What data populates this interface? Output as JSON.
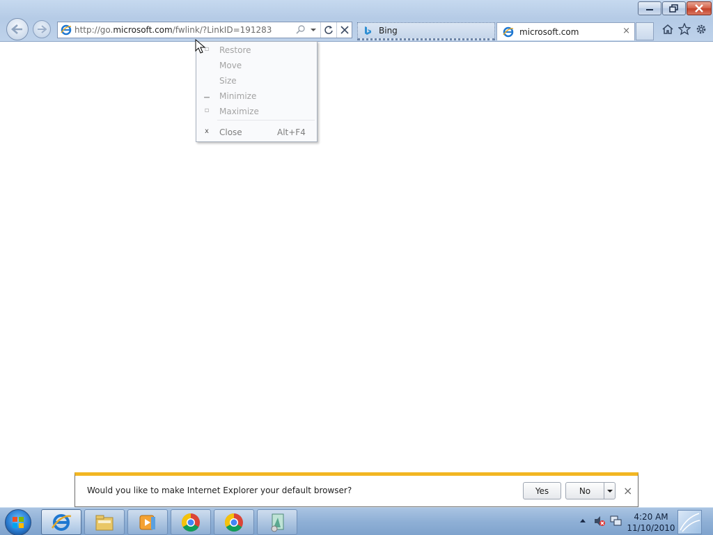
{
  "window": {
    "caption_buttons": [
      "minimize-icon",
      "restore-icon",
      "close-icon"
    ]
  },
  "nav": {
    "back_icon": "back-arrow-icon",
    "forward_icon": "forward-arrow-icon"
  },
  "address": {
    "url_prefix": "http://go.",
    "url_domain": "microsoft.com",
    "url_suffix": "/fwlink/?LinkID=191283",
    "search_icon": "search-icon",
    "dropdown_icon": "chevron-down-icon",
    "refresh_icon": "refresh-icon",
    "stop_icon": "stop-icon"
  },
  "tabs": [
    {
      "label": "Bing",
      "icon": "bing-icon",
      "active": false
    },
    {
      "label": "microsoft.com",
      "icon": "ie-icon",
      "active": true,
      "close": "×"
    }
  ],
  "toolbar": {
    "icons": [
      "home-icon",
      "favorites-star-icon",
      "settings-gear-icon"
    ]
  },
  "context_menu": {
    "items": [
      {
        "label": "Restore",
        "shortcut": "",
        "icon": "restore-icon"
      },
      {
        "label": "Move",
        "shortcut": "",
        "icon": ""
      },
      {
        "label": "Size",
        "shortcut": "",
        "icon": ""
      },
      {
        "label": "Minimize",
        "shortcut": "",
        "icon": "minimize-icon"
      },
      {
        "label": "Maximize",
        "shortcut": "",
        "icon": "maximize-icon"
      },
      {
        "label": "Close",
        "shortcut": "Alt+F4",
        "icon": "close-icon"
      }
    ]
  },
  "notification": {
    "message": "Would you like to make Internet Explorer your default browser?",
    "yes_label": "Yes",
    "no_label": "No",
    "accent_color": "#f2b622"
  },
  "taskbar": {
    "buttons": [
      "internet-explorer-icon",
      "windows-explorer-icon",
      "media-player-icon",
      "chrome-icon",
      "chrome-icon",
      "app-icon"
    ],
    "time": "4:20 AM",
    "date": "11/10/2010"
  }
}
